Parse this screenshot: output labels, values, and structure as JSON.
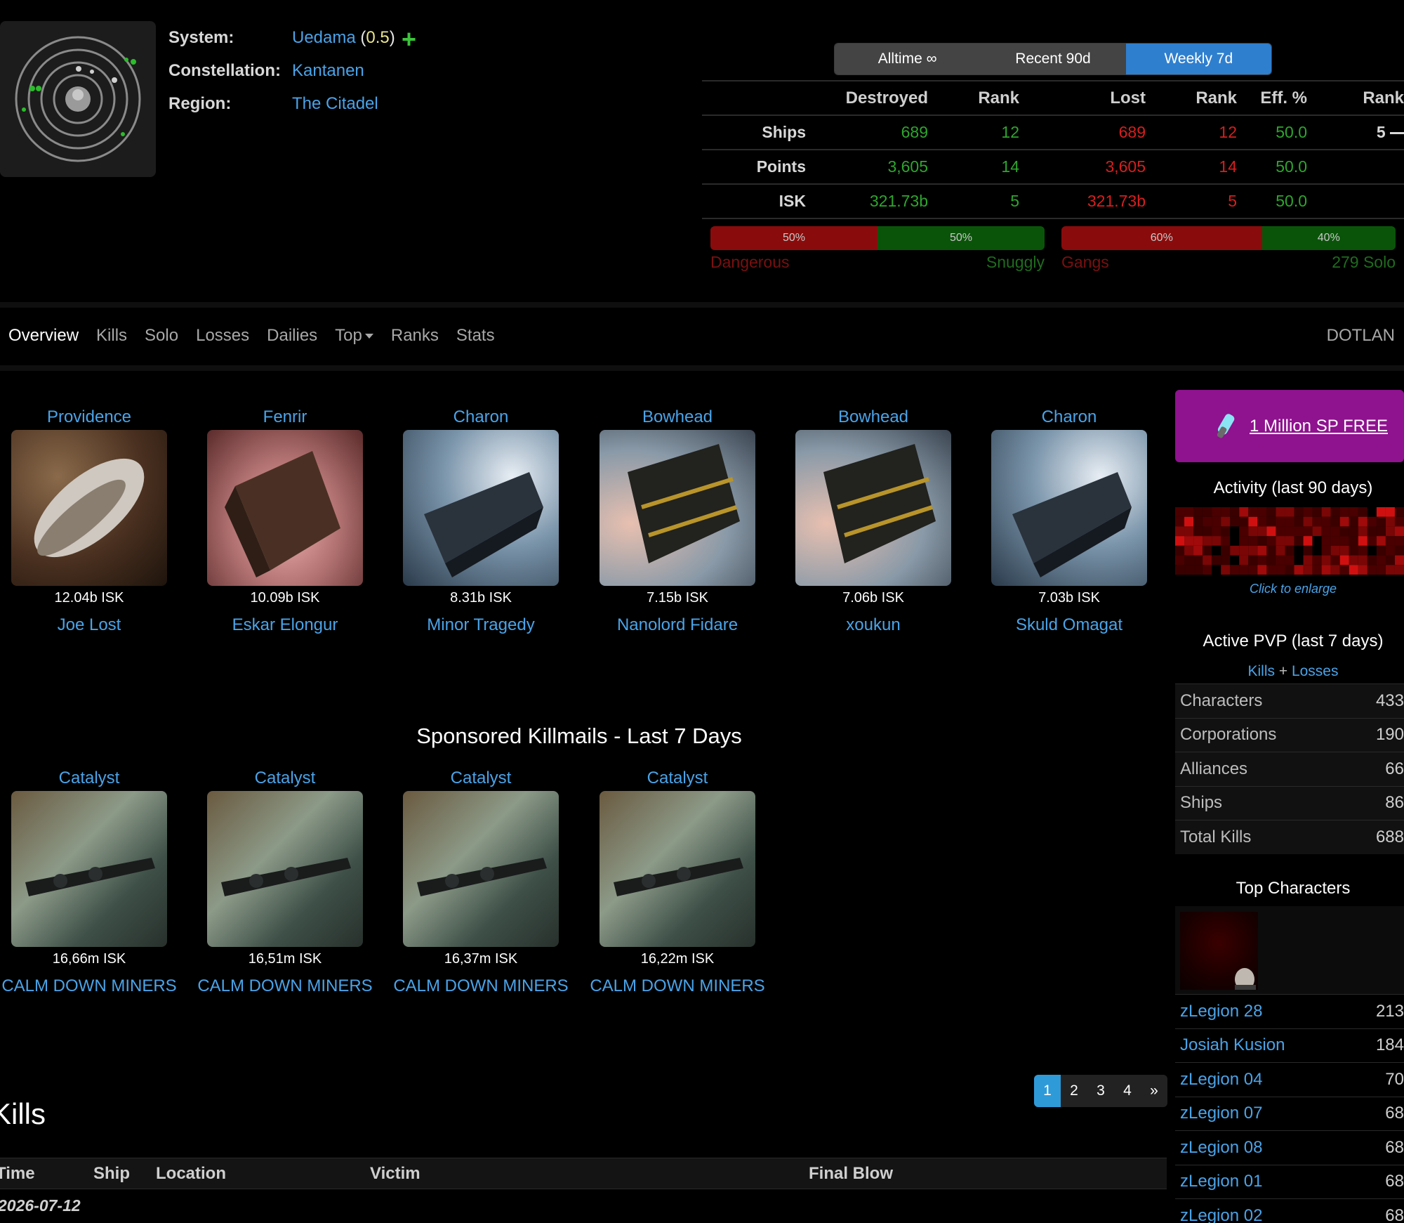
{
  "system": {
    "labels": {
      "system": "System:",
      "constellation": "Constellation:",
      "region": "Region:"
    },
    "name": "Uedama",
    "security": "0.5",
    "constellation": "Kantanen",
    "region": "The Citadel",
    "add_icon": "plus-icon"
  },
  "period_tabs": [
    "Alltime ∞",
    "Recent 90d",
    "Weekly 7d"
  ],
  "period_active": "Weekly 7d",
  "stats": {
    "headers": [
      "Destroyed",
      "Rank",
      "Lost",
      "Rank",
      "Eff. %",
      "Rank"
    ],
    "rows": [
      {
        "label": "Ships",
        "destroyed": "689",
        "destroyed_rank": "12",
        "lost": "689",
        "lost_rank": "12",
        "eff": "50.0",
        "eff_rank": "5"
      },
      {
        "label": "Points",
        "destroyed": "3,605",
        "destroyed_rank": "14",
        "lost": "3,605",
        "lost_rank": "14",
        "eff": "50.0",
        "eff_rank": ""
      },
      {
        "label": "ISK",
        "destroyed": "321.73b",
        "destroyed_rank": "5",
        "lost": "321.73b",
        "lost_rank": "5",
        "eff": "50.0",
        "eff_rank": ""
      }
    ]
  },
  "danger_bar": {
    "red_pct": "50%",
    "green_pct": "50%",
    "red_fraction": 0.5,
    "left_label": "Dangerous",
    "right_label": "Snuggly"
  },
  "gang_bar": {
    "red_pct": "60%",
    "green_pct": "40%",
    "red_fraction": 0.6,
    "left_label": "Gangs",
    "right_label": "279 Solo"
  },
  "nav": {
    "items": [
      "Overview",
      "Kills",
      "Solo",
      "Losses",
      "Dailies",
      "Top",
      "Ranks",
      "Stats"
    ],
    "active": "Overview",
    "right": "DOTLAN"
  },
  "top_kills": [
    {
      "ship": "Providence",
      "isk": "12.04b ISK",
      "pilot": "Joe Lost"
    },
    {
      "ship": "Fenrir",
      "isk": "10.09b ISK",
      "pilot": "Eskar Elongur"
    },
    {
      "ship": "Charon",
      "isk": "8.31b ISK",
      "pilot": "Minor Tragedy"
    },
    {
      "ship": "Bowhead",
      "isk": "7.15b ISK",
      "pilot": "Nanolord Fidare"
    },
    {
      "ship": "Bowhead",
      "isk": "7.06b ISK",
      "pilot": "xoukun"
    },
    {
      "ship": "Charon",
      "isk": "7.03b ISK",
      "pilot": "Skuld Omagat"
    }
  ],
  "sponsored": {
    "title": "Sponsored Killmails - Last 7 Days",
    "items": [
      {
        "ship": "Catalyst",
        "isk": "16,66m ISK",
        "pilot": "CALM DOWN MINERS"
      },
      {
        "ship": "Catalyst",
        "isk": "16,51m ISK",
        "pilot": "CALM DOWN MINERS"
      },
      {
        "ship": "Catalyst",
        "isk": "16,37m ISK",
        "pilot": "CALM DOWN MINERS"
      },
      {
        "ship": "Catalyst",
        "isk": "16,22m ISK",
        "pilot": "CALM DOWN MINERS"
      }
    ]
  },
  "pagination": {
    "pages": [
      "1",
      "2",
      "3",
      "4",
      "»"
    ],
    "active": "1"
  },
  "kills": {
    "heading": "Kills",
    "columns": [
      "Time",
      "Ship",
      "Location",
      "Victim",
      "Final Blow"
    ],
    "first_date": "2026-07-12"
  },
  "sidebar": {
    "promo": "1 Million SP FREE",
    "activity_title": "Activity (last 90 days)",
    "enlarge": "Click to enlarge",
    "pvp_title": "Active PVP (last 7 days)",
    "pvp_links": {
      "kills": "Kills",
      "plus": "+",
      "losses": "Losses"
    },
    "pvp_rows": [
      {
        "label": "Characters",
        "value": "433"
      },
      {
        "label": "Corporations",
        "value": "190"
      },
      {
        "label": "Alliances",
        "value": "66"
      },
      {
        "label": "Ships",
        "value": "86"
      },
      {
        "label": "Total Kills",
        "value": "688"
      }
    ],
    "top_title": "Top Characters",
    "top_rows": [
      {
        "name": "zLegion 28",
        "value": "213"
      },
      {
        "name": "Josiah Kusion",
        "value": "184"
      },
      {
        "name": "zLegion 04",
        "value": "70"
      },
      {
        "name": "zLegion 07",
        "value": "68"
      },
      {
        "name": "zLegion 08",
        "value": "68"
      },
      {
        "name": "zLegion 01",
        "value": "68"
      },
      {
        "name": "zLegion 02",
        "value": "68"
      }
    ]
  }
}
